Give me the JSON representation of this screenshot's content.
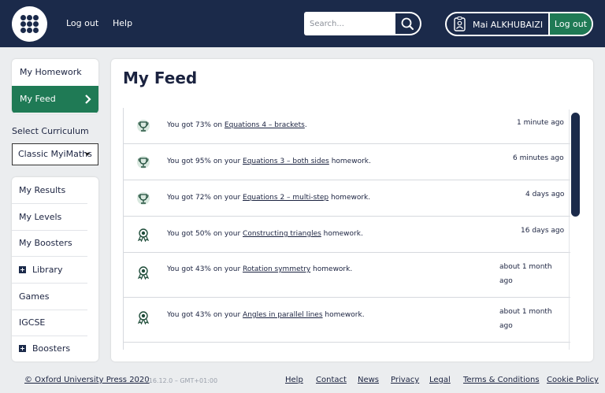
{
  "header": {
    "logout_link": "Log out",
    "help_link": "Help",
    "search_placeholder": "Search...",
    "user_name": "Mai ALKHUBAIZI",
    "logout_button": "Log out",
    "icons": {
      "logo": "grid-dots-icon",
      "search": "search-icon",
      "user": "user-badge-icon"
    }
  },
  "nav_top": {
    "items": [
      {
        "label": "My Homework",
        "active": false
      },
      {
        "label": "My Feed",
        "active": true
      }
    ]
  },
  "curriculum": {
    "label": "Select Curriculum",
    "selected": "Classic MyiMaths"
  },
  "nav_list": {
    "items": [
      {
        "label": "My Results",
        "expandable": false
      },
      {
        "label": "My Levels",
        "expandable": false
      },
      {
        "label": "My Boosters",
        "expandable": false
      },
      {
        "label": "Library",
        "expandable": true
      },
      {
        "label": "Games",
        "expandable": false
      },
      {
        "label": "IGCSE",
        "expandable": false
      },
      {
        "label": "Boosters",
        "expandable": true
      }
    ]
  },
  "main": {
    "title": "My Feed",
    "feed": [
      {
        "icon": "trophy-icon",
        "prefix": "You got 73% on ",
        "link": "Equations 4 – brackets",
        "suffix": ".",
        "time": "1 minute ago"
      },
      {
        "icon": "trophy-icon",
        "prefix": "You got 95% on your ",
        "link": "Equations 3 – both sides",
        "suffix": " homework.",
        "time": "6 minutes ago"
      },
      {
        "icon": "trophy-icon",
        "prefix": "You got 72% on your ",
        "link": "Equations 2 – multi-step",
        "suffix": " homework.",
        "time": "4 days ago"
      },
      {
        "icon": "rosette-icon",
        "prefix": "You got 50% on your ",
        "link": "Constructing triangles",
        "suffix": " homework.",
        "time": "16 days ago"
      },
      {
        "icon": "rosette-icon",
        "prefix": "You got 43% on your ",
        "link": "Rotation symmetry",
        "suffix": " homework.",
        "time_line1": "about 1 month",
        "time_line2": "ago"
      },
      {
        "icon": "rosette-icon",
        "prefix": "You got 43% on your ",
        "link": "Angles in parallel lines",
        "suffix": " homework.",
        "time_line1": "about 1 month",
        "time_line2": "ago"
      }
    ]
  },
  "footer": {
    "copyright": "© Oxford University Press 2020",
    "version": "v16.12.0 – GMT+01:00",
    "links": [
      "Help",
      "Contact",
      "News",
      "Privacy",
      "Legal",
      "Terms & Conditions",
      "Cookie Policy"
    ]
  },
  "colors": {
    "navy": "#1b2a4a",
    "green": "#1f7a55",
    "background": "#ebedef"
  }
}
